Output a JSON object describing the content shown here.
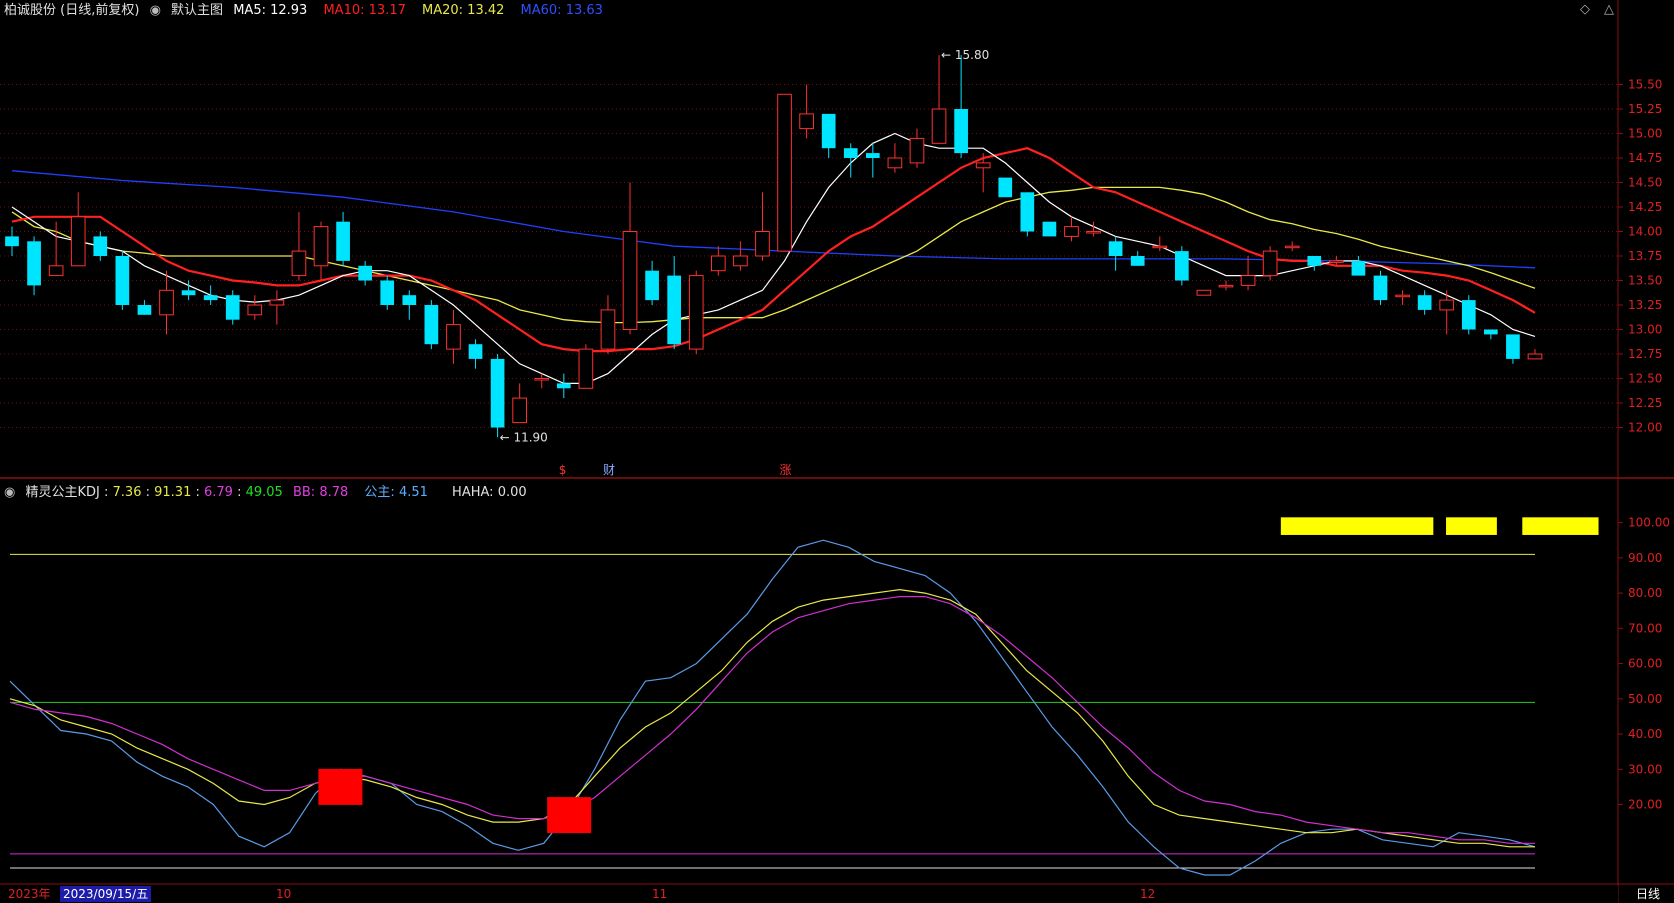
{
  "header": {
    "title": "柏诚股份 (日线,前复权)",
    "main_chart_label": "默认主图",
    "ma5": {
      "label": "MA5:",
      "value": "12.93",
      "color": "#ffffff"
    },
    "ma10": {
      "label": "MA10:",
      "value": "13.17",
      "color": "#ff2020"
    },
    "ma20": {
      "label": "MA20:",
      "value": "13.42",
      "color": "#e8e84a"
    },
    "ma60": {
      "label": "MA60:",
      "value": "13.63",
      "color": "#2040ff"
    }
  },
  "indicator_header": {
    "name": "精灵公主KDJ",
    "v1": "7.36",
    "v2": "91.31",
    "v3": "6.79",
    "v4": "49.05",
    "bb_label": "BB:",
    "bb_value": "8.78",
    "gz_label": "公主:",
    "gz_value": "4.51",
    "haha_label": "HAHA:",
    "haha_value": "0.00"
  },
  "footer": {
    "year": "2023年",
    "date": "2023/09/15/五",
    "months": [
      {
        "label": "10"
      },
      {
        "label": "11"
      },
      {
        "label": "12"
      }
    ],
    "period": "日线"
  },
  "markers": [
    {
      "text": "$",
      "color": "#ff3030",
      "candle": 25
    },
    {
      "text": "财",
      "color": "#8aa8ff",
      "candle": 27
    },
    {
      "text": "涨",
      "color": "#ff3030",
      "candle": 35
    }
  ],
  "chart_data": [
    {
      "type": "candlestick",
      "price_axis": {
        "min": 11.75,
        "max": 15.75,
        "ticks": [
          12.0,
          12.25,
          12.5,
          12.75,
          13.0,
          13.25,
          13.5,
          13.75,
          14.0,
          14.25,
          14.5,
          14.75,
          15.0,
          15.25,
          15.5
        ]
      },
      "annotations": [
        {
          "text": "15.80",
          "candle": 42,
          "value": 15.8
        },
        {
          "text": "11.90",
          "candle": 22,
          "value": 11.9
        }
      ],
      "colors": {
        "up": "#ff3030",
        "down": "#00e5ff",
        "ma5": "#ffffff",
        "ma10": "#ff2020",
        "ma20": "#e8e84a",
        "ma60": "#2040ff"
      },
      "candles": [
        [
          13.95,
          13.85,
          14.05,
          13.75
        ],
        [
          13.9,
          13.45,
          13.95,
          13.35
        ],
        [
          13.55,
          13.65,
          14.1,
          13.55
        ],
        [
          13.65,
          14.15,
          14.4,
          13.65
        ],
        [
          13.95,
          13.75,
          14.0,
          13.7
        ],
        [
          13.75,
          13.25,
          13.8,
          13.2
        ],
        [
          13.25,
          13.15,
          13.3,
          13.15
        ],
        [
          13.15,
          13.4,
          13.6,
          12.95
        ],
        [
          13.4,
          13.35,
          13.5,
          13.3
        ],
        [
          13.35,
          13.3,
          13.45,
          13.25
        ],
        [
          13.35,
          13.1,
          13.4,
          13.05
        ],
        [
          13.15,
          13.25,
          13.35,
          13.1
        ],
        [
          13.25,
          13.3,
          13.4,
          13.05
        ],
        [
          13.55,
          13.8,
          14.2,
          13.5
        ],
        [
          13.65,
          14.05,
          14.1,
          13.5
        ],
        [
          14.1,
          13.7,
          14.2,
          13.65
        ],
        [
          13.65,
          13.5,
          13.7,
          13.45
        ],
        [
          13.5,
          13.25,
          13.55,
          13.2
        ],
        [
          13.35,
          13.25,
          13.4,
          13.1
        ],
        [
          13.25,
          12.85,
          13.3,
          12.8
        ],
        [
          12.8,
          13.05,
          13.2,
          12.65
        ],
        [
          12.85,
          12.7,
          12.9,
          12.6
        ],
        [
          12.7,
          12.0,
          12.75,
          11.9
        ],
        [
          12.05,
          12.3,
          12.45,
          12.05
        ],
        [
          12.5,
          12.5,
          12.55,
          12.4
        ],
        [
          12.45,
          12.4,
          12.55,
          12.3
        ],
        [
          12.4,
          12.8,
          12.85,
          12.4
        ],
        [
          12.8,
          13.2,
          13.35,
          12.75
        ],
        [
          13.0,
          14.0,
          14.5,
          12.95
        ],
        [
          13.6,
          13.3,
          13.7,
          13.25
        ],
        [
          13.55,
          12.85,
          13.75,
          12.8
        ],
        [
          12.8,
          13.55,
          13.6,
          12.75
        ],
        [
          13.6,
          13.75,
          13.85,
          13.55
        ],
        [
          13.65,
          13.75,
          13.9,
          13.6
        ],
        [
          13.75,
          14.0,
          14.4,
          13.7
        ],
        [
          13.8,
          15.4,
          15.4,
          13.8
        ],
        [
          15.05,
          15.2,
          15.5,
          14.95
        ],
        [
          15.2,
          14.85,
          15.2,
          14.75
        ],
        [
          14.85,
          14.75,
          14.9,
          14.55
        ],
        [
          14.8,
          14.75,
          14.9,
          14.55
        ],
        [
          14.65,
          14.75,
          14.9,
          14.6
        ],
        [
          14.7,
          14.95,
          15.05,
          14.65
        ],
        [
          14.9,
          15.25,
          15.8,
          14.9
        ],
        [
          15.25,
          14.8,
          15.8,
          14.75
        ],
        [
          14.65,
          14.7,
          14.8,
          14.4
        ],
        [
          14.55,
          14.35,
          14.55,
          14.35
        ],
        [
          14.4,
          14.0,
          14.4,
          13.95
        ],
        [
          14.1,
          13.95,
          14.1,
          13.95
        ],
        [
          13.95,
          14.05,
          14.15,
          13.9
        ],
        [
          14.0,
          14.0,
          14.1,
          13.95
        ],
        [
          13.9,
          13.75,
          13.95,
          13.6
        ],
        [
          13.75,
          13.65,
          13.8,
          13.65
        ],
        [
          13.85,
          13.85,
          13.95,
          13.8
        ],
        [
          13.8,
          13.5,
          13.85,
          13.45
        ],
        [
          13.35,
          13.4,
          13.4,
          13.35
        ],
        [
          13.45,
          13.45,
          13.5,
          13.4
        ],
        [
          13.45,
          13.55,
          13.75,
          13.4
        ],
        [
          13.55,
          13.8,
          13.85,
          13.5
        ],
        [
          13.85,
          13.85,
          13.9,
          13.8
        ],
        [
          13.75,
          13.65,
          13.75,
          13.6
        ],
        [
          13.7,
          13.7,
          13.75,
          13.65
        ],
        [
          13.7,
          13.55,
          13.75,
          13.55
        ],
        [
          13.55,
          13.3,
          13.6,
          13.25
        ],
        [
          13.35,
          13.35,
          13.4,
          13.25
        ],
        [
          13.35,
          13.2,
          13.4,
          13.15
        ],
        [
          13.2,
          13.3,
          13.4,
          12.95
        ],
        [
          13.3,
          13.0,
          13.35,
          12.95
        ],
        [
          13.0,
          12.95,
          13.0,
          12.9
        ],
        [
          12.95,
          12.7,
          12.95,
          12.65
        ],
        [
          12.7,
          12.75,
          12.8,
          12.7
        ]
      ],
      "ma5": [
        14.25,
        14.1,
        13.95,
        13.9,
        13.85,
        13.8,
        13.65,
        13.55,
        13.45,
        13.35,
        13.3,
        13.28,
        13.3,
        13.35,
        13.45,
        13.55,
        13.6,
        13.6,
        13.55,
        13.4,
        13.25,
        13.05,
        12.85,
        12.65,
        12.55,
        12.45,
        12.45,
        12.55,
        12.75,
        12.95,
        13.1,
        13.15,
        13.2,
        13.3,
        13.4,
        13.7,
        14.1,
        14.45,
        14.7,
        14.9,
        15.0,
        14.9,
        14.85,
        14.85,
        14.85,
        14.7,
        14.5,
        14.3,
        14.15,
        14.05,
        13.95,
        13.9,
        13.85,
        13.75,
        13.65,
        13.55,
        13.55,
        13.55,
        13.6,
        13.65,
        13.7,
        13.7,
        13.65,
        13.55,
        13.45,
        13.35,
        13.25,
        13.15,
        13.0,
        12.93
      ],
      "ma10": [
        14.1,
        14.15,
        14.15,
        14.15,
        14.15,
        14.0,
        13.85,
        13.7,
        13.6,
        13.55,
        13.5,
        13.48,
        13.45,
        13.45,
        13.5,
        13.55,
        13.55,
        13.55,
        13.55,
        13.5,
        13.4,
        13.3,
        13.15,
        13.0,
        12.85,
        12.8,
        12.78,
        12.78,
        12.8,
        12.8,
        12.83,
        12.9,
        13.0,
        13.1,
        13.2,
        13.4,
        13.6,
        13.8,
        13.95,
        14.05,
        14.2,
        14.35,
        14.5,
        14.65,
        14.75,
        14.8,
        14.85,
        14.75,
        14.6,
        14.45,
        14.4,
        14.3,
        14.2,
        14.1,
        14.0,
        13.9,
        13.8,
        13.72,
        13.7,
        13.7,
        13.65,
        13.65,
        13.65,
        13.6,
        13.58,
        13.55,
        13.5,
        13.4,
        13.3,
        13.17
      ],
      "ma20": [
        14.2,
        14.05,
        14.0,
        13.9,
        13.85,
        13.8,
        13.78,
        13.75,
        13.75,
        13.75,
        13.75,
        13.75,
        13.75,
        13.75,
        13.7,
        13.65,
        13.6,
        13.55,
        13.5,
        13.45,
        13.4,
        13.35,
        13.3,
        13.2,
        13.15,
        13.1,
        13.08,
        13.07,
        13.07,
        13.08,
        13.1,
        13.12,
        13.12,
        13.12,
        13.12,
        13.2,
        13.3,
        13.4,
        13.5,
        13.6,
        13.7,
        13.8,
        13.95,
        14.1,
        14.2,
        14.3,
        14.35,
        14.4,
        14.42,
        14.45,
        14.45,
        14.45,
        14.45,
        14.42,
        14.38,
        14.3,
        14.2,
        14.12,
        14.08,
        14.02,
        13.98,
        13.92,
        13.85,
        13.8,
        13.75,
        13.7,
        13.65,
        13.58,
        13.5,
        13.42
      ],
      "ma60_points": [
        [
          0,
          14.62
        ],
        [
          5,
          14.52
        ],
        [
          10,
          14.45
        ],
        [
          15,
          14.35
        ],
        [
          20,
          14.2
        ],
        [
          25,
          14.0
        ],
        [
          30,
          13.85
        ],
        [
          35,
          13.8
        ],
        [
          40,
          13.75
        ],
        [
          45,
          13.72
        ],
        [
          50,
          13.72
        ],
        [
          55,
          13.72
        ],
        [
          60,
          13.7
        ],
        [
          65,
          13.67
        ],
        [
          69,
          13.63
        ]
      ]
    },
    {
      "type": "line",
      "y_axis": {
        "min": 0,
        "max": 105,
        "ticks": [
          20,
          30,
          40,
          50,
          60,
          70,
          80,
          90,
          100
        ]
      },
      "ref_lines": [
        {
          "value": 91,
          "color": "#e8e84a"
        },
        {
          "value": 49,
          "color": "#20d020"
        },
        {
          "value": 6,
          "color": "#d030d0"
        },
        {
          "value": 2,
          "color": "#e0e0e0"
        }
      ],
      "series": [
        {
          "color": "#5a9ae6",
          "values": [
            55,
            48,
            41,
            40,
            38,
            32,
            28,
            25,
            20,
            11,
            8,
            12,
            23,
            30,
            28,
            26,
            20,
            18,
            14,
            9,
            7,
            9,
            18,
            30,
            44,
            55,
            56,
            60,
            67,
            74,
            84,
            93,
            95,
            93,
            89,
            87,
            85,
            80,
            72,
            62,
            52,
            42,
            34,
            25,
            15,
            8,
            2,
            0,
            0,
            4,
            9,
            12,
            13,
            13,
            10,
            9,
            8,
            12,
            11,
            10,
            8
          ]
        },
        {
          "color": "#e8e84a",
          "values": [
            50,
            48,
            44,
            42,
            40,
            36,
            33,
            30,
            26,
            21,
            20,
            22,
            26,
            28,
            27,
            25,
            22,
            20,
            17,
            15,
            15,
            16,
            20,
            28,
            36,
            42,
            46,
            52,
            58,
            66,
            72,
            76,
            78,
            79,
            80,
            81,
            80,
            78,
            74,
            66,
            58,
            52,
            46,
            38,
            28,
            20,
            17,
            16,
            15,
            14,
            13,
            12,
            12,
            13,
            12,
            11,
            10,
            9,
            9,
            8,
            8
          ]
        },
        {
          "color": "#d030d0",
          "values": [
            49,
            47,
            46,
            45,
            43,
            40,
            37,
            33,
            30,
            27,
            24,
            24,
            26,
            28,
            28,
            26,
            24,
            22,
            20,
            17,
            16,
            16,
            18,
            22,
            28,
            34,
            40,
            47,
            55,
            63,
            69,
            73,
            75,
            77,
            78,
            79,
            79,
            77,
            73,
            68,
            62,
            56,
            49,
            42,
            36,
            29,
            24,
            21,
            20,
            18,
            17,
            15,
            14,
            13,
            12,
            12,
            11,
            10,
            10,
            9,
            9
          ]
        }
      ],
      "signals": [
        {
          "index": 13,
          "value": 25
        },
        {
          "index": 22,
          "value": 17
        }
      ],
      "bars_top": [
        {
          "from": 50,
          "to": 56
        },
        {
          "from": 56.5,
          "to": 58.5
        },
        {
          "from": 59.5,
          "to": 62.5
        }
      ]
    }
  ]
}
